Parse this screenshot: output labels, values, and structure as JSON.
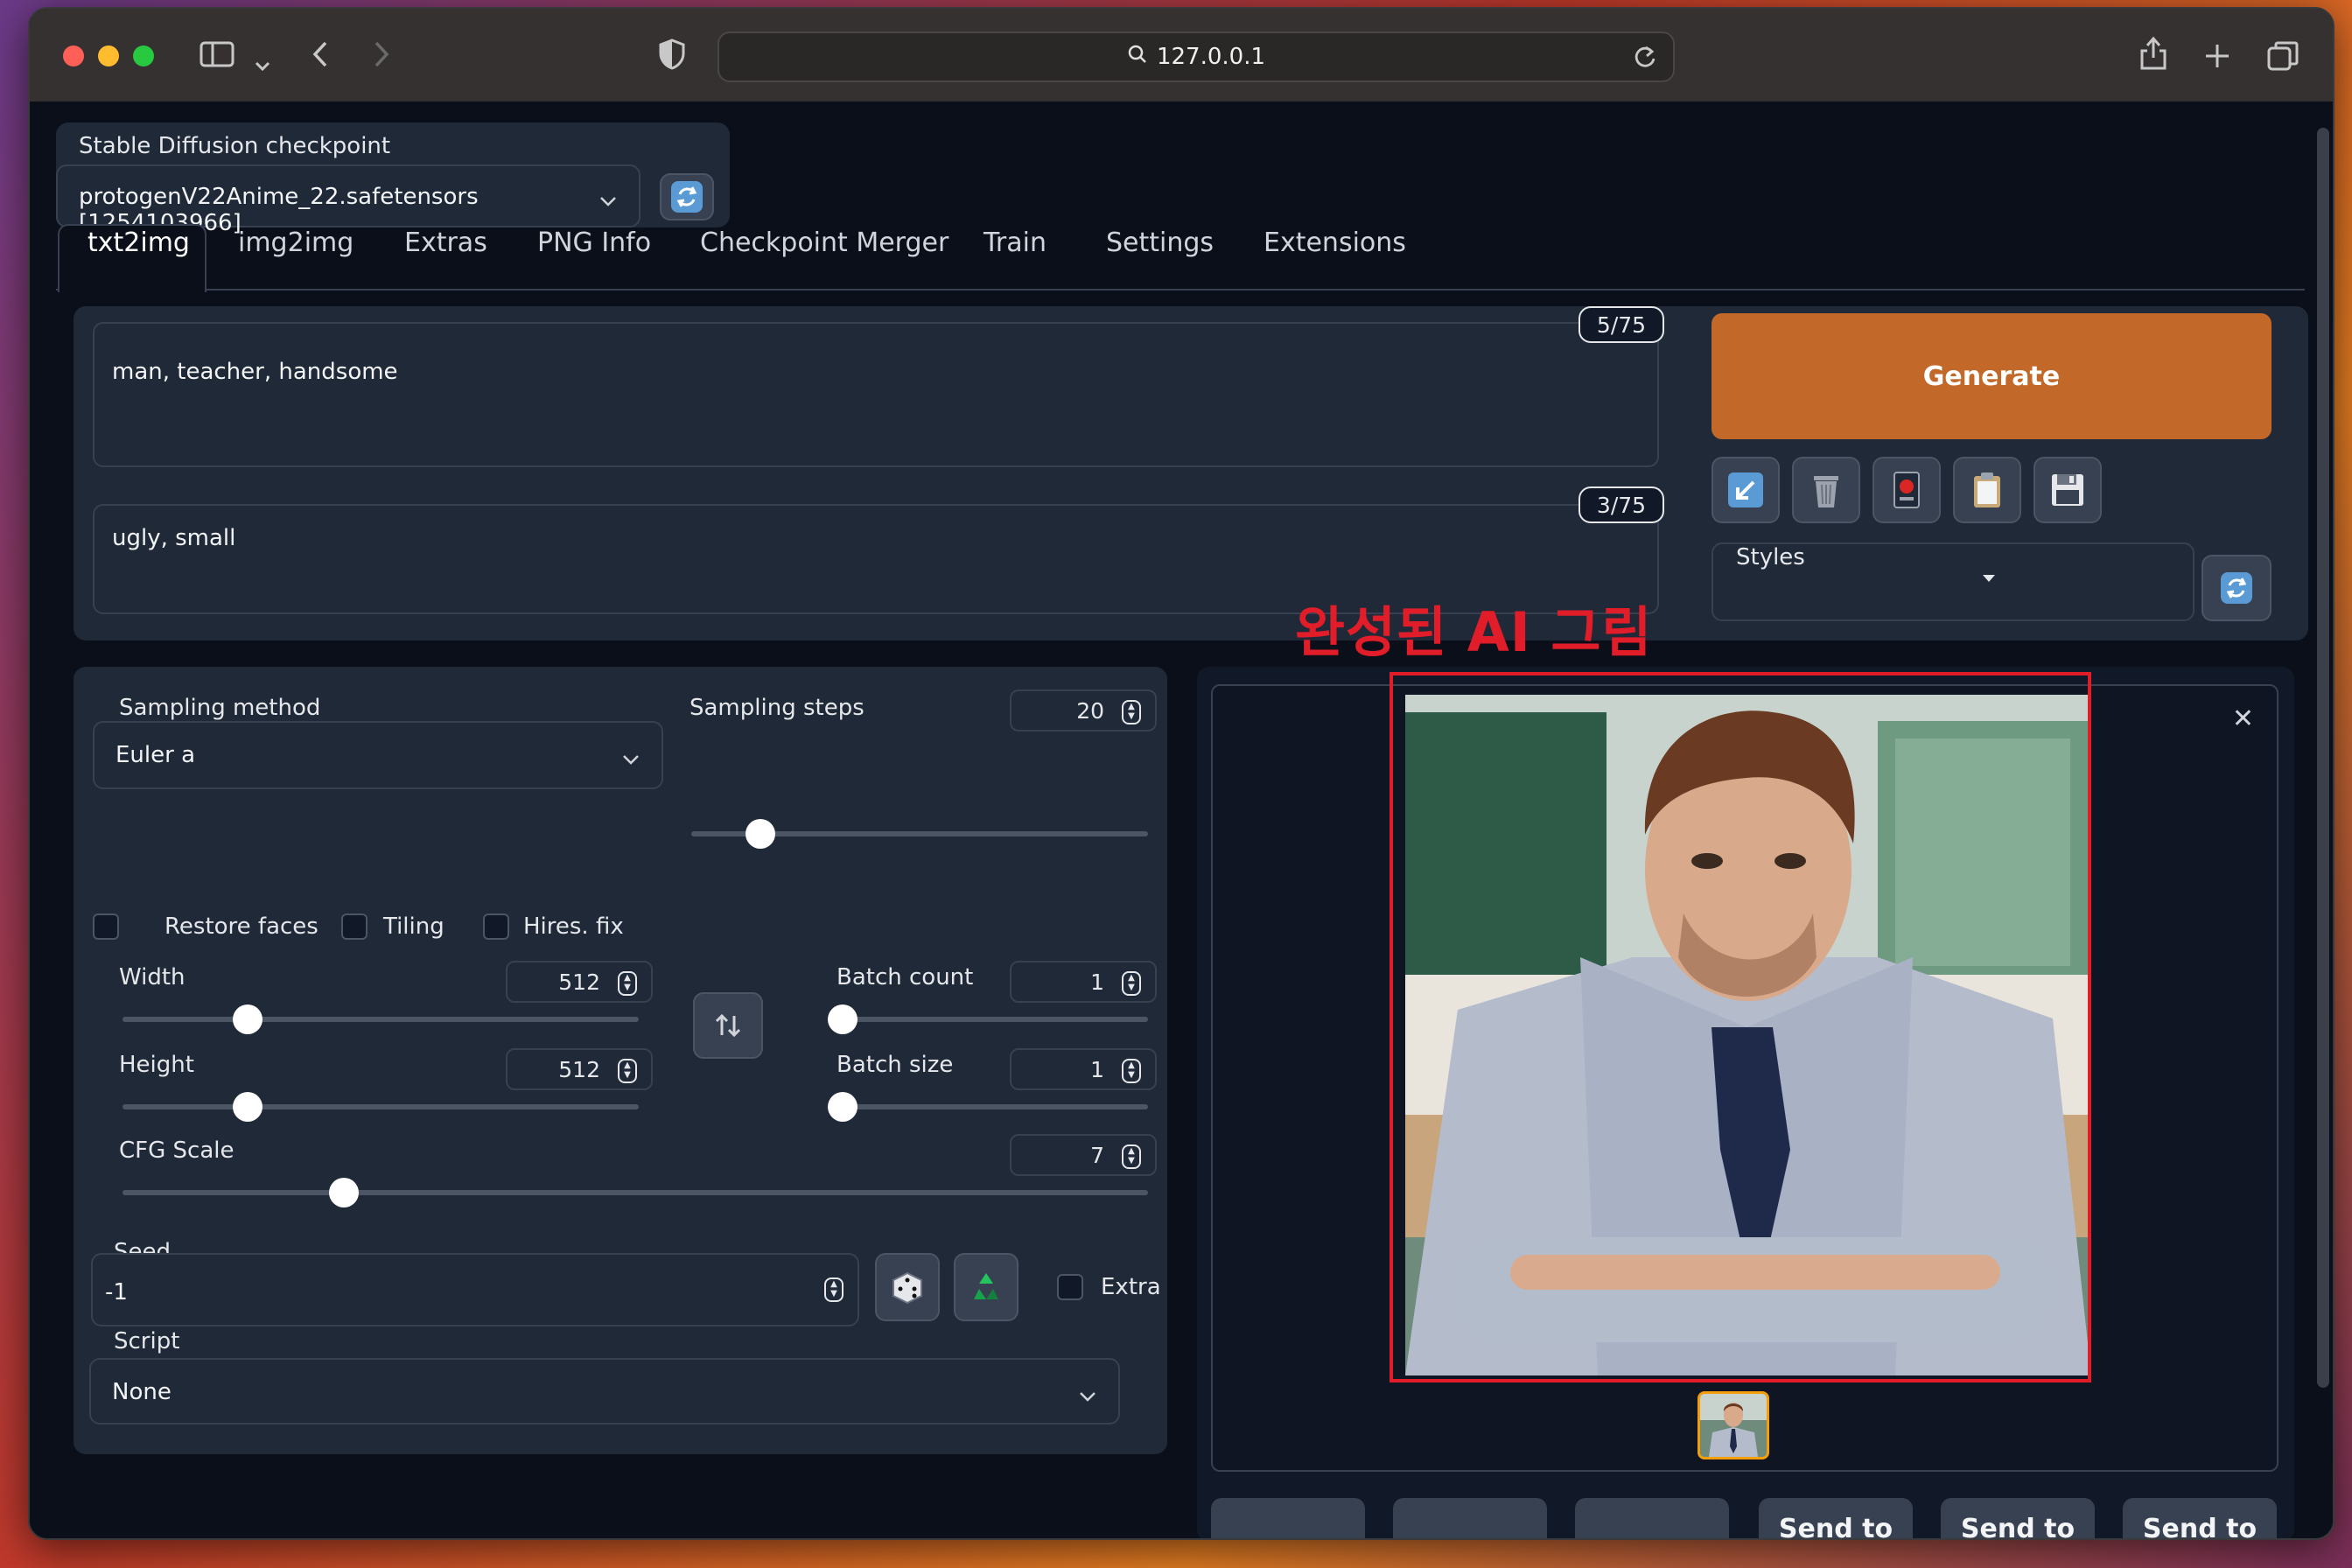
{
  "browser": {
    "url": "127.0.0.1"
  },
  "checkpoint": {
    "label": "Stable Diffusion checkpoint",
    "value": "protogenV22Anime_22.safetensors [1254103966]"
  },
  "tabs": [
    {
      "label": "txt2img"
    },
    {
      "label": "img2img"
    },
    {
      "label": "Extras"
    },
    {
      "label": "PNG Info"
    },
    {
      "label": "Checkpoint Merger"
    },
    {
      "label": "Train"
    },
    {
      "label": "Settings"
    },
    {
      "label": "Extensions"
    }
  ],
  "prompt": {
    "positive": "man, teacher, handsome",
    "positive_tokens": "5/75",
    "negative": "ugly, small",
    "negative_tokens": "3/75"
  },
  "actions": {
    "generate": "Generate",
    "styles_label": "Styles"
  },
  "annotation": "완성된 AI 그림",
  "sampling": {
    "method_label": "Sampling method",
    "method_value": "Euler a",
    "steps_label": "Sampling steps",
    "steps_value": "20"
  },
  "options": {
    "restore_faces": "Restore faces",
    "tiling": "Tiling",
    "hires_fix": "Hires. fix"
  },
  "size": {
    "width_label": "Width",
    "width_value": "512",
    "height_label": "Height",
    "height_value": "512"
  },
  "batch": {
    "count_label": "Batch count",
    "count_value": "1",
    "size_label": "Batch size",
    "size_value": "1"
  },
  "cfg": {
    "label": "CFG Scale",
    "value": "7"
  },
  "seed": {
    "label": "Seed",
    "value": "-1",
    "extra_label": "Extra"
  },
  "script": {
    "label": "Script",
    "value": "None"
  },
  "output_buttons": [
    {
      "label": ""
    },
    {
      "label": ""
    },
    {
      "label": ""
    },
    {
      "label": "Send to"
    },
    {
      "label": "Send to"
    },
    {
      "label": "Send to"
    }
  ],
  "colors": {
    "generate": "#c2692a",
    "annotation_red": "#e11d2a",
    "app_bg": "#0b0f19",
    "panel_bg": "#1f2937"
  },
  "icons": {
    "refresh": "refresh-icon",
    "dice": "dice-icon",
    "recycle": "recycle-icon",
    "swap": "swap-icon",
    "close": "close-icon"
  }
}
